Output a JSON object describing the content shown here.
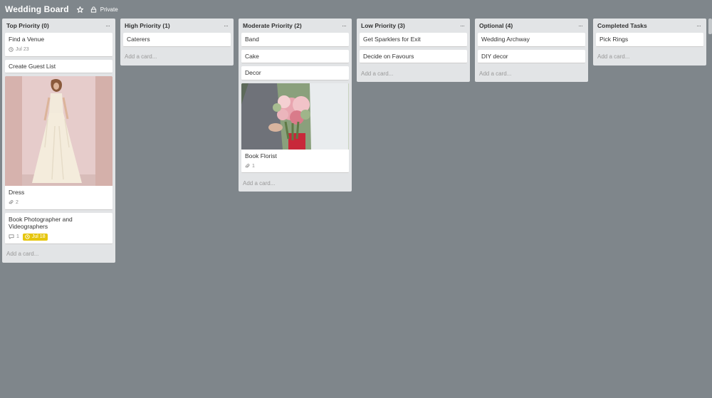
{
  "board": {
    "title": "Wedding Board",
    "visibility": "Private"
  },
  "lists": [
    {
      "title": "Top Priority (0)",
      "add_card": "Add a card...",
      "cards": [
        {
          "title": "Find a Venue",
          "due": "Jul 23"
        },
        {
          "title": "Create Guest List"
        },
        {
          "title": "Dress",
          "cover": "dress-photo",
          "attachments": "2"
        },
        {
          "title": "Book Photographer and Videographers",
          "comments": "1",
          "due_soon": "Jul 18"
        }
      ]
    },
    {
      "title": "High Priority (1)",
      "add_card": "Add a card...",
      "cards": [
        {
          "title": "Caterers"
        }
      ]
    },
    {
      "title": "Moderate Priority (2)",
      "add_card": "Add a card...",
      "cards": [
        {
          "title": "Band"
        },
        {
          "title": "Cake"
        },
        {
          "title": "Decor"
        },
        {
          "title": "Book Florist",
          "cover": "bouquet-photo",
          "attachments": "1"
        }
      ]
    },
    {
      "title": "Low Priority (3)",
      "add_card": "Add a card...",
      "cards": [
        {
          "title": "Get Sparklers for Exit"
        },
        {
          "title": "Decide on Favours"
        }
      ]
    },
    {
      "title": "Optional (4)",
      "add_card": "Add a card...",
      "cards": [
        {
          "title": "Wedding Archway"
        },
        {
          "title": "DIY decor"
        }
      ]
    },
    {
      "title": "Completed Tasks",
      "add_card": "Add a card...",
      "cards": [
        {
          "title": "Pick Rings"
        }
      ]
    }
  ],
  "colors": {
    "background": "#7f868b",
    "list": "#e2e4e6",
    "due_soon": "#e6c60d"
  },
  "icons": {
    "star": "star-icon",
    "private": "lock-icon",
    "due": "clock-icon",
    "attachment": "paperclip-icon",
    "comment": "comment-icon",
    "menu": "ellipsis-icon"
  }
}
